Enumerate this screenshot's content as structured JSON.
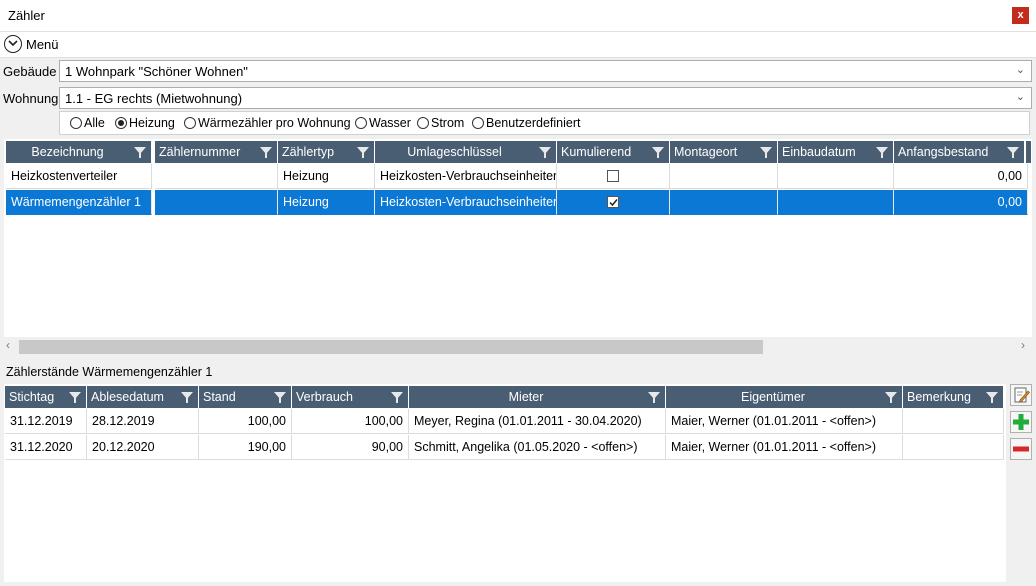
{
  "window": {
    "title": "Zähler",
    "close_label": "x"
  },
  "menu": {
    "label": "Menü"
  },
  "filters": {
    "gebaeude_label": "Gebäude",
    "gebaeude_value": "1 Wohnpark \"Schöner Wohnen\"",
    "wohnung_label": "Wohnung",
    "wohnung_value": "1.1 - EG rechts (Mietwohnung)"
  },
  "types": {
    "options": [
      "Alle",
      "Heizung",
      "Wärmezähler pro Wohnung",
      "Wasser",
      "Strom",
      "Benutzerdefiniert"
    ],
    "selected": "Heizung"
  },
  "meters": {
    "columns": [
      "Bezeichnung",
      "Zählernummer",
      "Zählertyp",
      "Umlageschlüssel",
      "Kumulierend",
      "Montageort",
      "Einbaudatum",
      "Anfangsbestand"
    ],
    "rows": [
      {
        "bezeichnung": "Heizkostenverteiler",
        "nummer": "",
        "typ": "Heizung",
        "schluessel": "Heizkosten-Verbrauchseinheiten",
        "kumulierend": false,
        "montageort": "",
        "einbaudatum": "",
        "anfangsbestand": "0,00",
        "selected": false
      },
      {
        "bezeichnung": "Wärmemengenzähler 1",
        "nummer": "",
        "typ": "Heizung",
        "schluessel": "Heizkosten-Verbrauchseinheiten",
        "kumulierend": true,
        "montageort": "",
        "einbaudatum": "",
        "anfangsbestand": "0,00",
        "selected": true
      }
    ]
  },
  "readings": {
    "title": "Zählerstände Wärmemengenzähler 1",
    "columns": [
      "Stichtag",
      "Ablesedatum",
      "Stand",
      "Verbrauch",
      "Mieter",
      "Eigentümer",
      "Bemerkung"
    ],
    "rows": [
      {
        "stichtag": "31.12.2019",
        "ablesedatum": "28.12.2019",
        "stand": "100,00",
        "verbrauch": "100,00",
        "mieter": "Meyer, Regina (01.01.2011 - 30.04.2020)",
        "eigentuemer": "Maier, Werner (01.01.2011 - <offen>)",
        "bemerkung": ""
      },
      {
        "stichtag": "31.12.2020",
        "ablesedatum": "20.12.2020",
        "stand": "190,00",
        "verbrauch": "90,00",
        "mieter": "Schmitt, Angelika (01.05.2020 - <offen>)",
        "eigentuemer": "Maier, Werner (01.01.2011 - <offen>)",
        "bemerkung": ""
      }
    ]
  },
  "actions": {
    "edit_icon": "edit-icon",
    "add_icon": "plus-icon",
    "remove_icon": "minus-icon"
  },
  "colors": {
    "header": "#4a5e73",
    "selection": "#0a78d4",
    "add": "#1fae3a",
    "remove": "#d9262d"
  }
}
